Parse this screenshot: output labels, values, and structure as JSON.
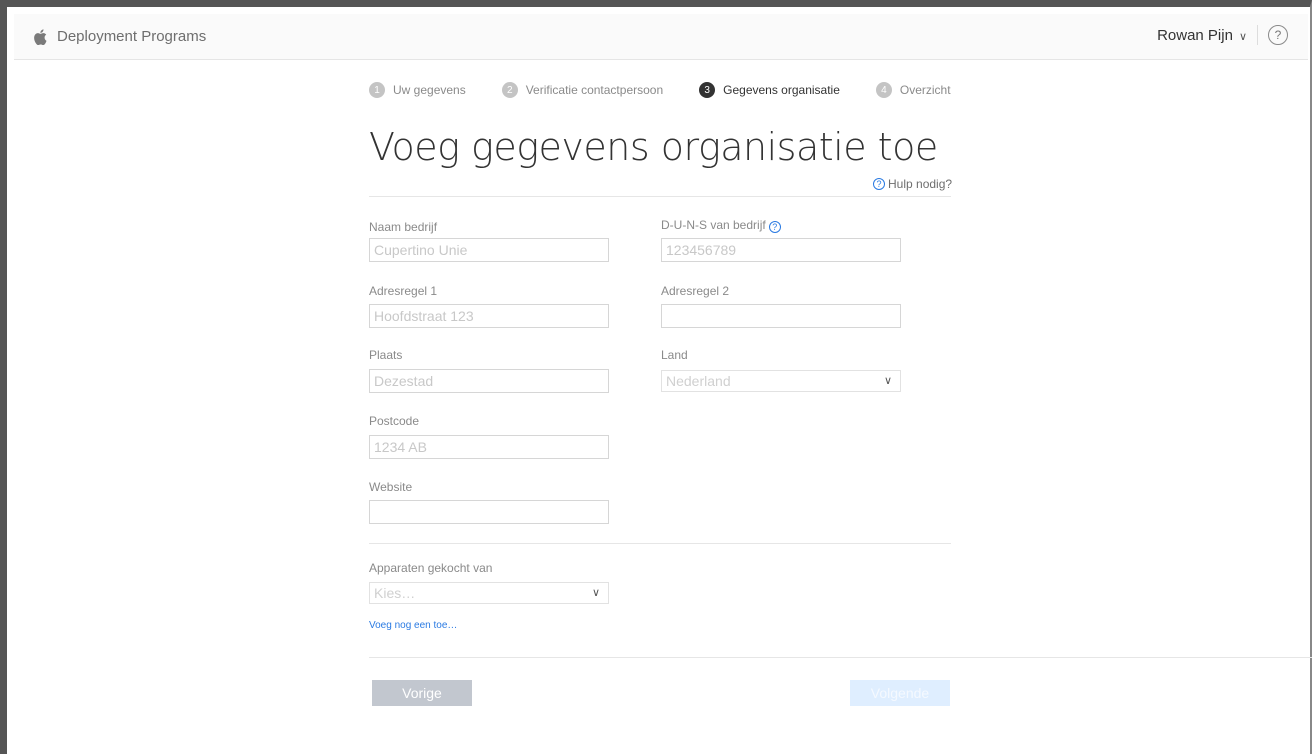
{
  "header": {
    "brand": "Deployment Programs",
    "user_name": "Rowan Pijn",
    "help_symbol": "?"
  },
  "steps": [
    {
      "num": "1",
      "label": "Uw gegevens",
      "active": false
    },
    {
      "num": "2",
      "label": "Verificatie contactpersoon",
      "active": false
    },
    {
      "num": "3",
      "label": "Gegevens organisatie",
      "active": true
    },
    {
      "num": "4",
      "label": "Overzicht",
      "active": false
    }
  ],
  "title": "Voeg gegevens organisatie toe",
  "help_link": "Hulp nodig?",
  "fields": {
    "company_name": {
      "label": "Naam bedrijf",
      "placeholder": "Cupertino Unie"
    },
    "duns": {
      "label": "D-U-N-S van bedrijf",
      "placeholder": "123456789"
    },
    "address1": {
      "label": "Adresregel 1",
      "placeholder": "Hoofdstraat 123"
    },
    "address2": {
      "label": "Adresregel 2",
      "placeholder": ""
    },
    "city": {
      "label": "Plaats",
      "placeholder": "Dezestad"
    },
    "country": {
      "label": "Land",
      "value": "Nederland"
    },
    "postcode": {
      "label": "Postcode",
      "placeholder": "1234 AB"
    },
    "website": {
      "label": "Website",
      "placeholder": ""
    },
    "purchased_from": {
      "label": "Apparaten gekocht van",
      "value": "Kies…"
    }
  },
  "add_link": "Voeg nog een toe…",
  "buttons": {
    "prev": "Vorige",
    "next": "Volgende"
  },
  "colors": {
    "link": "#2a7ae2",
    "prev_button": "#c2c7cf",
    "next_button": "#dfeeff"
  }
}
